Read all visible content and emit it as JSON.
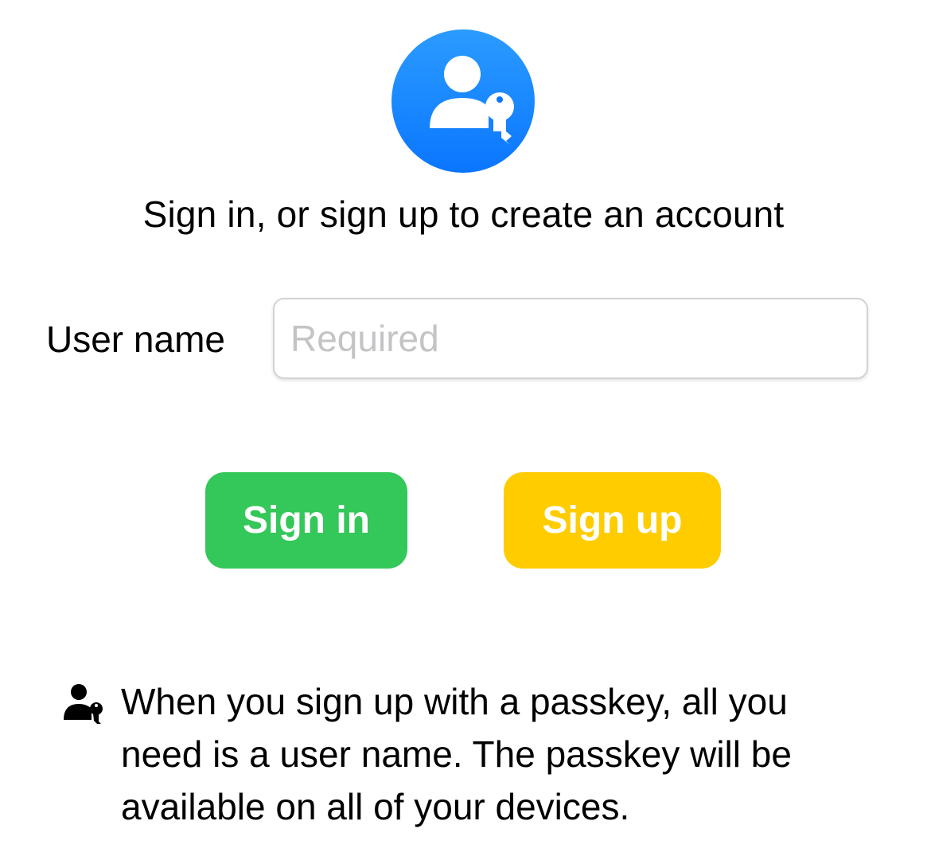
{
  "header": {
    "icon": "person-key-icon",
    "title": "Sign in, or sign up to create an account"
  },
  "form": {
    "username_label": "User name",
    "username_placeholder": "Required",
    "username_value": ""
  },
  "actions": {
    "sign_in_label": "Sign in",
    "sign_up_label": "Sign up"
  },
  "info": {
    "icon": "person-key-icon",
    "text": "When you sign up with a passkey, all you need is a user name. The passkey will be available on all of your devices."
  },
  "colors": {
    "accent_blue": "#0a76ff",
    "sign_in_green": "#34c759",
    "sign_up_yellow": "#ffcc00",
    "placeholder_gray": "#c4c4c6"
  }
}
